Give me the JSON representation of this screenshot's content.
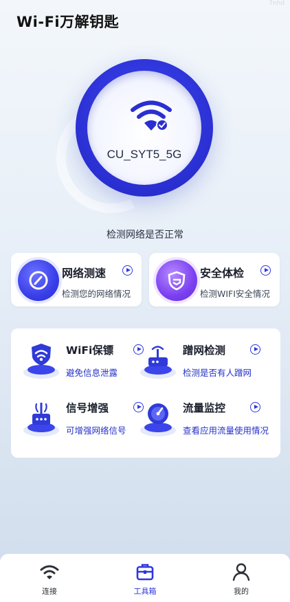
{
  "watermark": "7nhd",
  "app_title": "Wi-Fi万解钥匙",
  "hero": {
    "ssid": "CU_SYT5_5G",
    "check_label": "检测网络是否正常"
  },
  "cards": [
    {
      "title": "网络测速",
      "subtitle": "检测您的网络情况",
      "icon": "speedometer-icon"
    },
    {
      "title": "安全体检",
      "subtitle": "检测WIFI安全情况",
      "icon": "shield-icon"
    }
  ],
  "tools": [
    {
      "title": "WiFi保镖",
      "subtitle": "避免信息泄露",
      "icon": "wifi-guard-icon"
    },
    {
      "title": "蹭网检测",
      "subtitle": "检测是否有人蹭网",
      "icon": "router-icon"
    },
    {
      "title": "信号增强",
      "subtitle": "可增强网络信号",
      "icon": "signal-boost-icon"
    },
    {
      "title": "流量监控",
      "subtitle": "查看应用流量使用情况",
      "icon": "traffic-monitor-icon"
    }
  ],
  "tabbar": {
    "tabs": [
      {
        "label": "连接",
        "icon": "wifi-icon",
        "active": false
      },
      {
        "label": "工具箱",
        "icon": "toolbox-icon",
        "active": true
      },
      {
        "label": "我的",
        "icon": "user-icon",
        "active": false
      }
    ]
  },
  "colors": {
    "accent": "#2d36e0",
    "accent_dark": "#2128b8",
    "purple": "#7b3ff1",
    "background": "#e6eef7"
  }
}
